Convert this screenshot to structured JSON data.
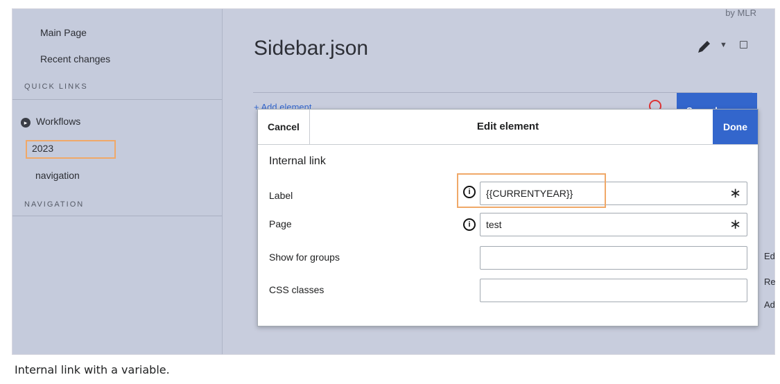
{
  "sidebar": {
    "links": [
      "Main Page",
      "Recent changes"
    ],
    "section_quick_links": "QUICK LINKS",
    "workflows": "Workflows",
    "item_2023": "2023",
    "item_navigation": "navigation",
    "section_navigation": "NAVIGATION"
  },
  "header": {
    "page_title": "Sidebar.json",
    "byline": "by MLR"
  },
  "toolbar": {
    "add_element": "+ Add element",
    "save_changes": "Save changes"
  },
  "right_edge_letters": [
    "Ed",
    "Re",
    "Ad"
  ],
  "dialog": {
    "cancel": "Cancel",
    "title": "Edit element",
    "done": "Done",
    "section": "Internal link",
    "fields": [
      {
        "label": "Label",
        "value": "{{CURRENTYEAR}}",
        "required": "∗",
        "info": "i"
      },
      {
        "label": "Page",
        "value": "test",
        "required": "∗",
        "info": "i"
      },
      {
        "label": "Show for groups",
        "value": ""
      },
      {
        "label": "CSS classes",
        "value": ""
      }
    ]
  },
  "caption": "Internal link with a variable.",
  "colors": {
    "accent": "#3366cc",
    "highlight": "#f0a868",
    "sidebar_bg": "#c5cbdc",
    "main_bg": "#c8cddd"
  }
}
